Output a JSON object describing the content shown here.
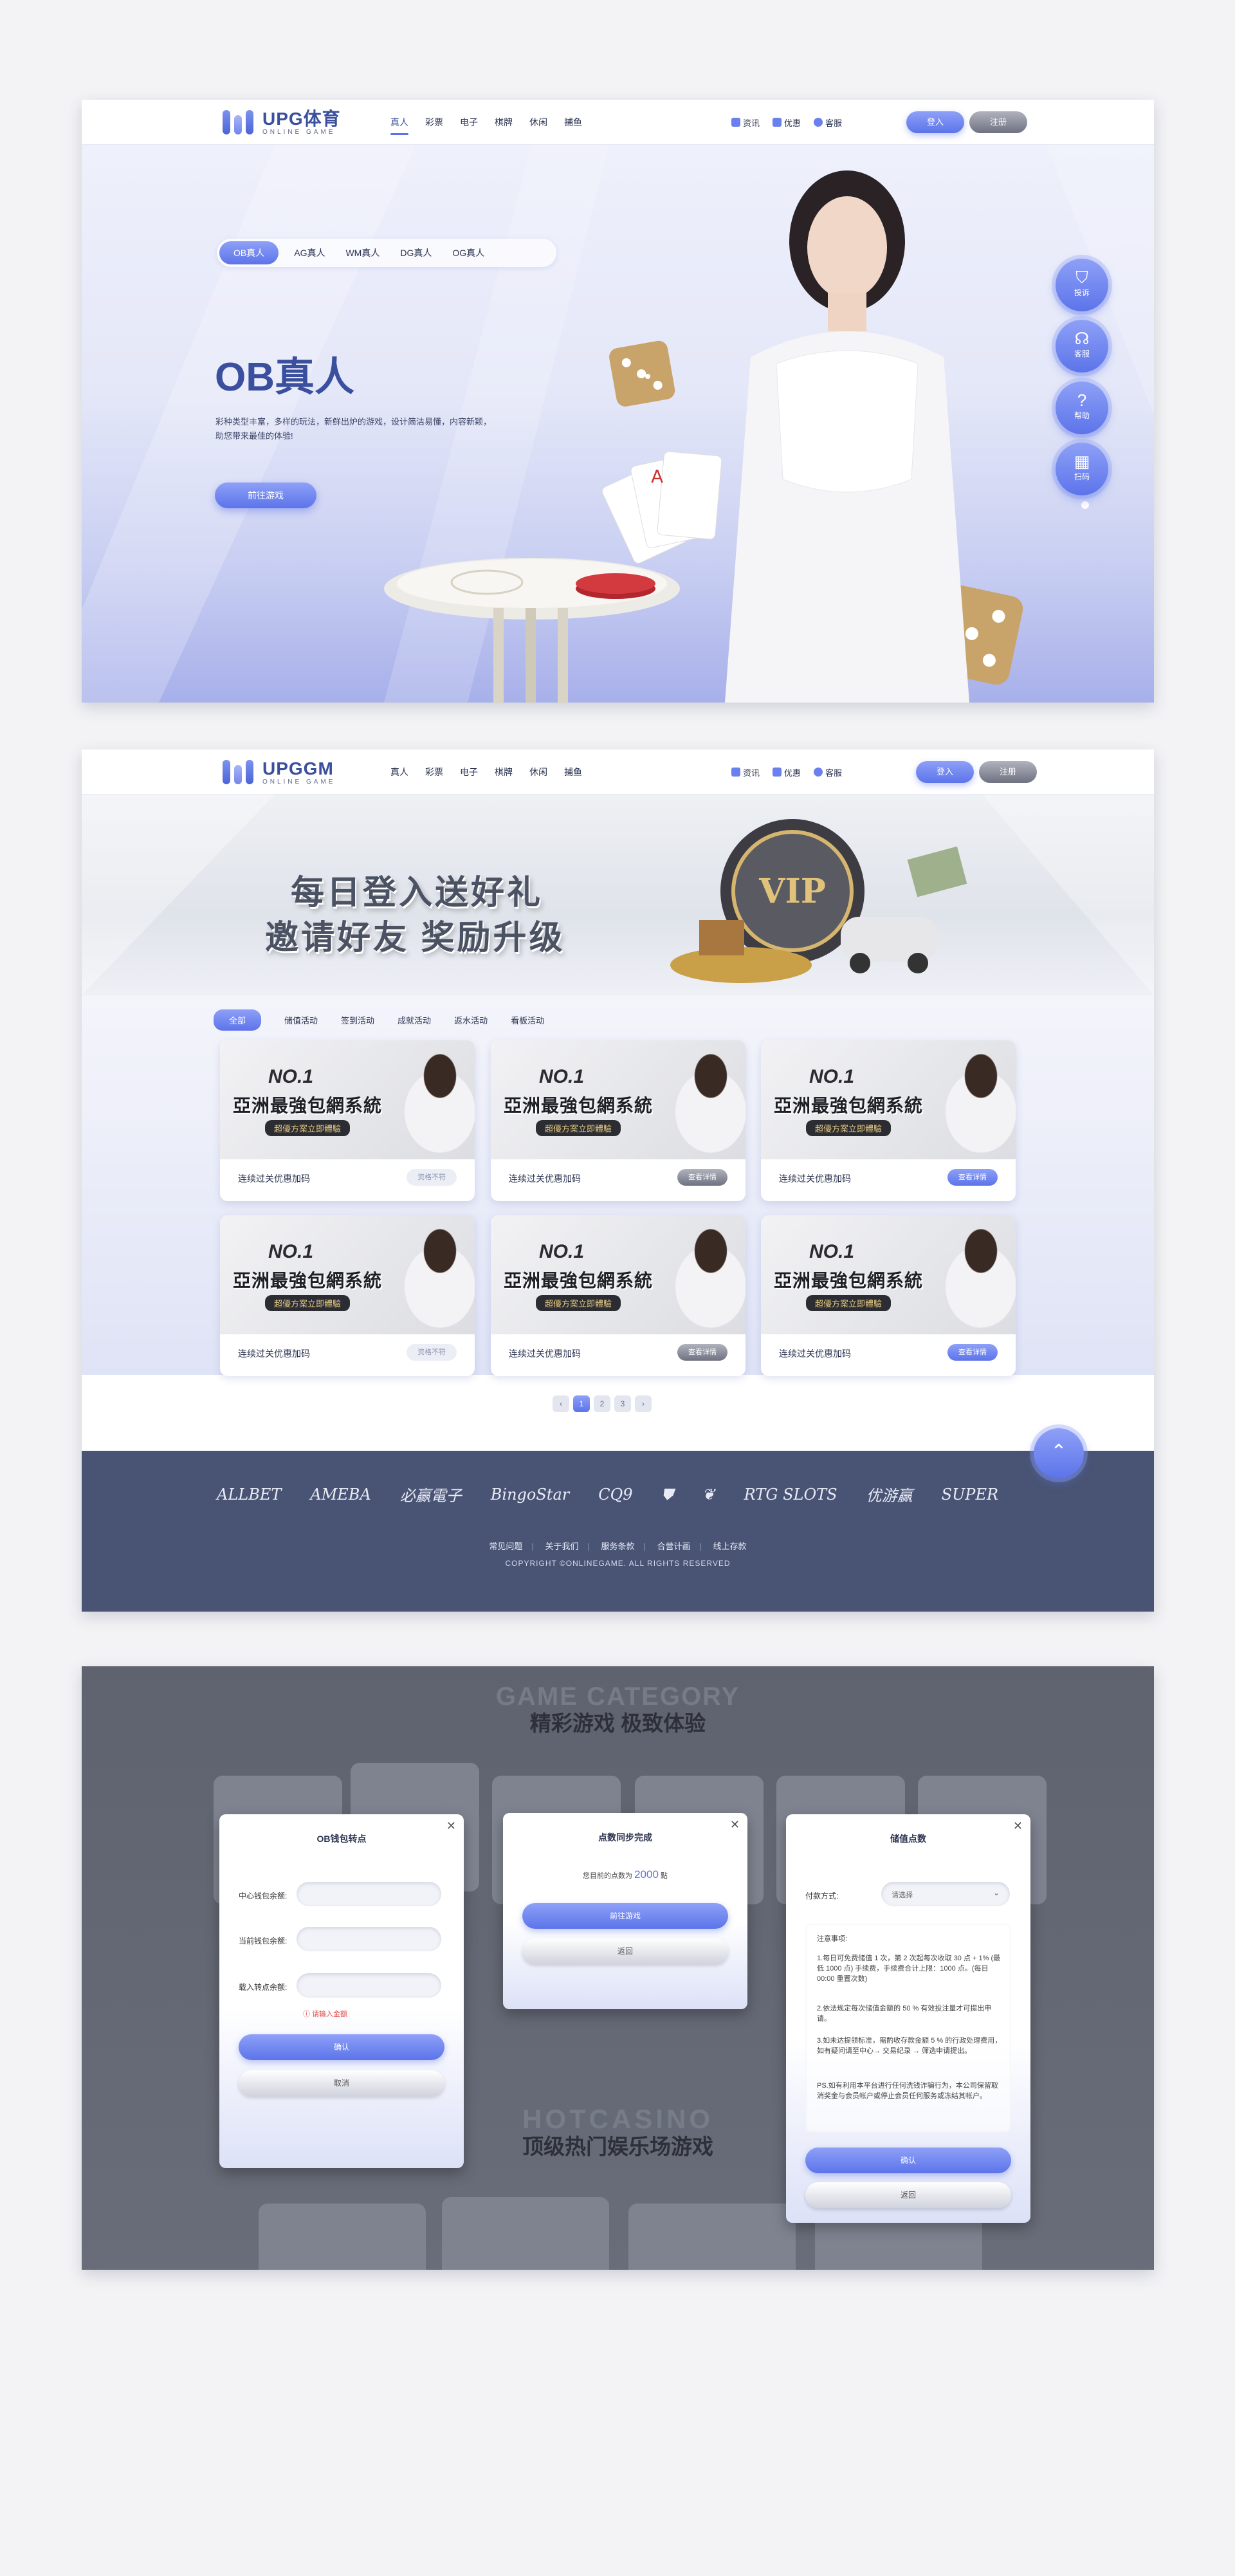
{
  "header1": {
    "logo_title": "UPG体育",
    "logo_sub": "ONLINE GAME",
    "nav": [
      "真人",
      "彩票",
      "电子",
      "棋牌",
      "休闲",
      "捕鱼"
    ],
    "util": [
      "资讯",
      "优惠",
      "客服"
    ],
    "login": "登入",
    "register": "注册"
  },
  "hero": {
    "tabs": [
      "OB真人",
      "AG真人",
      "WM真人",
      "DG真人",
      "OG真人"
    ],
    "title": "OB真人",
    "desc_line1": "彩种类型丰富，多样的玩法，新鲜出炉的游戏，设计简洁易懂，内容新颖，",
    "desc_line2": "助您带来最佳的体验!",
    "cta": "前往游戏",
    "side_buttons": [
      "投诉",
      "客服",
      "帮助",
      "扫码"
    ]
  },
  "header2": {
    "logo_title": "UPGGM",
    "logo_sub": "ONLINE GAME",
    "nav": [
      "真人",
      "彩票",
      "电子",
      "棋牌",
      "休闲",
      "捕鱼"
    ],
    "util": [
      "资讯",
      "优惠",
      "客服"
    ],
    "login": "登入",
    "register": "注册"
  },
  "banner": {
    "line1": "每日登入送好礼",
    "line2": "邀请好友 奖励升级",
    "vip": "VIP"
  },
  "promo": {
    "filters": [
      "全部",
      "储值活动",
      "签到活动",
      "成就活动",
      "返水活动",
      "看板活动"
    ],
    "card_no": "NO.1",
    "card_big": "亞洲最強包網系統",
    "card_sub": "超優方案立即體驗",
    "cards": [
      {
        "caption": "连续过关优惠加码",
        "button": "资格不符"
      },
      {
        "caption": "连续过关优惠加码",
        "button": "查看详情"
      },
      {
        "caption": "连续过关优惠加码",
        "button": "查看详情"
      },
      {
        "caption": "连续过关优惠加码",
        "button": "资格不符"
      },
      {
        "caption": "连续过关优惠加码",
        "button": "查看详情"
      },
      {
        "caption": "连续过关优惠加码",
        "button": "查看详情"
      }
    ],
    "pager": [
      "‹",
      "1",
      "2",
      "3",
      "›"
    ]
  },
  "footer": {
    "brands": [
      "ALLBET",
      "AMEBA",
      "必赢電子",
      "BingoStar",
      "CQ9",
      "",
      "",
      "RTG SLOTS",
      "优游赢",
      "SUPER"
    ],
    "links": [
      "常见问题",
      "关于我们",
      "服务条款",
      "合营计画",
      "线上存款"
    ],
    "copyright": "COPYRIGHT ©ONLINEGAME. ALL RIGHTS RESERVED"
  },
  "bg": {
    "cat_en": "GAME CATEGORY",
    "cat_cn": "精彩游戏 极致体验",
    "hot_en": "HOTCASINO",
    "hot_cn": "顶级热门娱乐场游戏"
  },
  "modal_wallet": {
    "title": "OB钱包转点",
    "labels": [
      "中心钱包余额:",
      "当前钱包余额:",
      "载入转点余额:"
    ],
    "error": "请输入金额",
    "confirm": "确认",
    "cancel": "取消"
  },
  "modal_sync": {
    "title": "点数同步完成",
    "text_prefix": "您目前的点数为",
    "points": "2000",
    "text_suffix": "點",
    "go": "前往游戏",
    "back": "返回"
  },
  "modal_deposit": {
    "title": "储值点数",
    "pay_label": "付款方式:",
    "pay_placeholder": "请选择",
    "notes_title": "注意事项:",
    "notes": [
      "1.每日可免费储值 1 次，第 2 次起每次收取 30 点 + 1% (最低 1000 点) 手续费，手续费合计上限：1000 点。(每日 00:00 重置次数)",
      "2.依法规定每次储值金额的 50 % 有效投注量才可提出申请。",
      "3.如未达提领标准，需酌收存款金额 5 % 的行政处理费用，如有疑问请至中心→ 交易纪录 → 筛选申请提出。",
      "PS.如有利用本平台进行任何洗钱诈骗行为，本公司保留取消奖金与会员帐户或停止会员任何服务或冻结其帐户。"
    ],
    "confirm": "确认",
    "cancel": "返回"
  }
}
